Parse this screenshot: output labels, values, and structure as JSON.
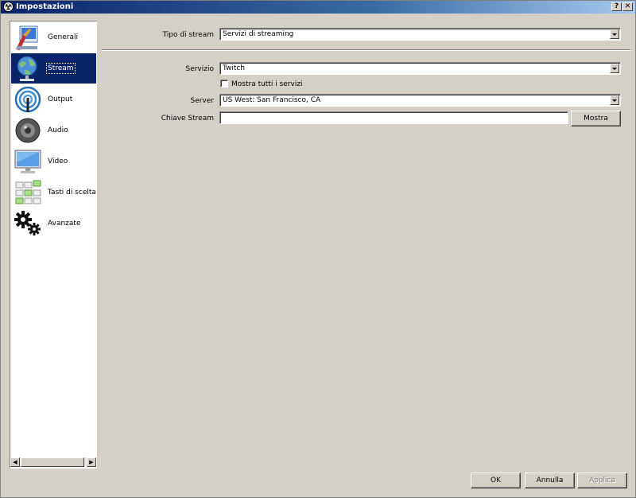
{
  "window": {
    "title": "Impostazioni",
    "help_label": "?",
    "close_label": "✕"
  },
  "sidebar": {
    "items": [
      {
        "label": "Generali",
        "icon": "general-settings-icon",
        "active": false
      },
      {
        "label": "Stream",
        "icon": "globe-network-icon",
        "active": true
      },
      {
        "label": "Output",
        "icon": "broadcast-antenna-icon",
        "active": false
      },
      {
        "label": "Audio",
        "icon": "speaker-icon",
        "active": false
      },
      {
        "label": "Video",
        "icon": "monitor-icon",
        "active": false
      },
      {
        "label": "Tasti di scelta ra",
        "icon": "keyboard-shortcuts-icon",
        "active": false
      },
      {
        "label": "Avanzate",
        "icon": "gears-icon",
        "active": false
      }
    ]
  },
  "stream": {
    "type_label": "Tipo di stream",
    "type_value": "Servizi di streaming",
    "service_label": "Servizio",
    "service_value": "Twitch",
    "show_all_label": "Mostra tutti i servizi",
    "show_all_checked": false,
    "server_label": "Server",
    "server_value": "US West: San Francisco, CA",
    "key_label": "Chiave Stream",
    "key_value": "",
    "show_key_button": "Mostra"
  },
  "footer": {
    "ok": "OK",
    "cancel": "Annulla",
    "apply": "Applica"
  },
  "colors": {
    "face": "#d4d0c8",
    "selection": "#0a246a",
    "title_gradient_start": "#0a246a",
    "title_gradient_end": "#a6caf0"
  }
}
